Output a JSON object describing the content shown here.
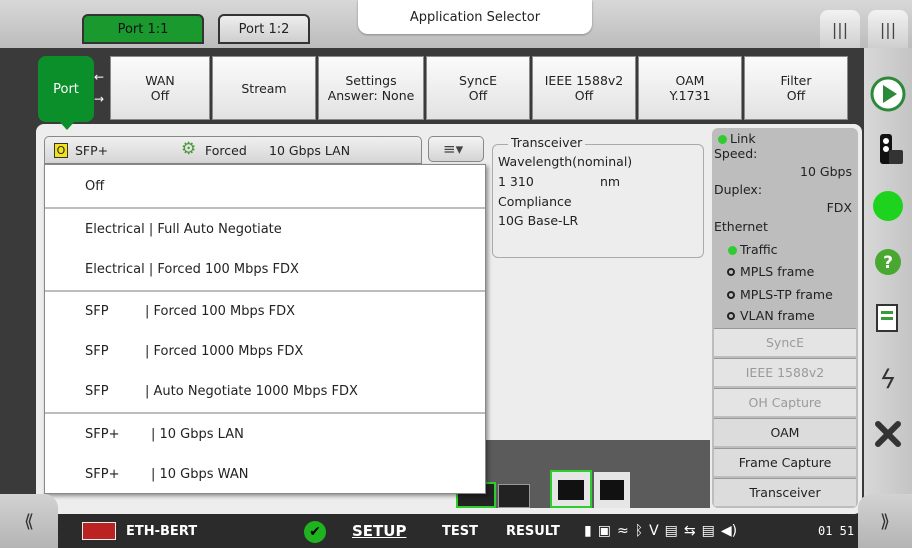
{
  "top": {
    "port_tabs": [
      "Port 1:1",
      "Port 1:2"
    ],
    "app_selector": "Application Selector"
  },
  "func_tabs": {
    "port": "Port",
    "wan": [
      "WAN",
      "Off"
    ],
    "stream": "Stream",
    "settings": [
      "Settings",
      "Answer: None"
    ],
    "synce": [
      "SyncE",
      "Off"
    ],
    "ieee": [
      "IEEE 1588v2",
      "Off"
    ],
    "oam": [
      "OAM",
      "Y.1731"
    ],
    "filter": [
      "Filter",
      "Off"
    ]
  },
  "interface": {
    "badge": "O",
    "type": "SFP+",
    "mode": "Forced",
    "rate": "10 Gbps LAN"
  },
  "transceiver": {
    "legend": "Transceiver",
    "wavelength_label": "Wavelength(nominal)",
    "wavelength_value": "1 310",
    "wavelength_unit": "nm",
    "compliance_label": "Compliance",
    "compliance_value": "10G Base-LR"
  },
  "status": {
    "link": "Link",
    "speed_label": "Speed:",
    "speed_value": "10 Gbps",
    "duplex_label": "Duplex:",
    "duplex_value": "FDX",
    "ethernet": "Ethernet",
    "items": [
      "Traffic",
      "MPLS frame",
      "MPLS-TP frame",
      "VLAN frame"
    ],
    "buttons": [
      "SyncE",
      "IEEE 1588v2",
      "OH Capture",
      "OAM",
      "Frame Capture",
      "Transceiver"
    ],
    "led_green": "#2ecc2e"
  },
  "dropdown": {
    "options": [
      {
        "a": "Off",
        "b": ""
      },
      {
        "a": "Electrical | Full Auto Negotiate",
        "b": ""
      },
      {
        "a": "Electrical | Forced 100 Mbps FDX",
        "b": ""
      },
      {
        "a": "SFP",
        "b": "| Forced 100 Mbps FDX"
      },
      {
        "a": "SFP",
        "b": "| Forced 1000 Mbps FDX"
      },
      {
        "a": "SFP",
        "b": "| Auto Negotiate 1000 Mbps FDX"
      },
      {
        "a": "SFP+",
        "b": "| 10 Gbps LAN"
      },
      {
        "a": "SFP+",
        "b": "| 10 Gbps WAN"
      }
    ]
  },
  "bottom": {
    "app_name": "ETH-BERT",
    "setup": "SETUP",
    "test": "TEST",
    "result": "RESULT",
    "clock": "01 51",
    "left_chevron": "⟪",
    "right_chevron": "⟫"
  },
  "colors": {
    "accent_green": "#0a8f2a"
  }
}
